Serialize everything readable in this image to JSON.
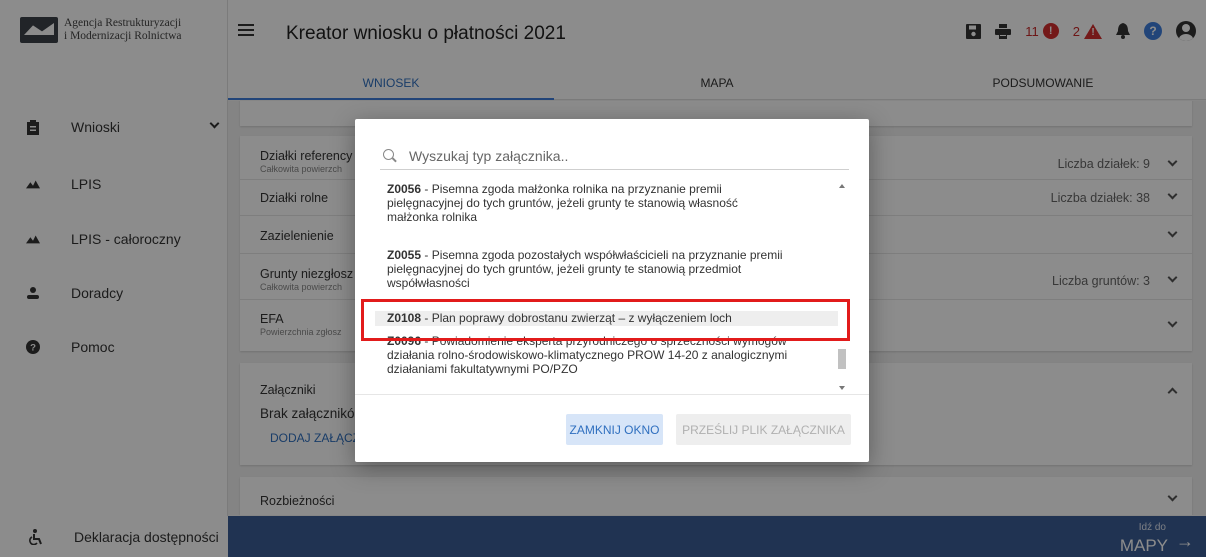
{
  "logo": {
    "line1": "Agencja Restrukturyzacji",
    "line2": "i Modernizacji Rolnictwa"
  },
  "sidebar": {
    "items": [
      {
        "label": "Wnioski",
        "icon": "clipboard-icon"
      },
      {
        "label": "LPIS",
        "icon": "mountain-icon"
      },
      {
        "label": "LPIS - całoroczny",
        "icon": "mountain-icon"
      },
      {
        "label": "Doradcy",
        "icon": "person-icon"
      },
      {
        "label": "Pomoc",
        "icon": "help-icon"
      }
    ],
    "accessibility": "Deklaracja dostępności"
  },
  "header": {
    "title": "Kreator wniosku o płatności 2021",
    "errors_count": "11",
    "warnings_count": "2",
    "errors_glyph": "!",
    "warnings_glyph": "!",
    "help_glyph": "?"
  },
  "tabs": [
    {
      "label": "WNIOSEK",
      "active": true
    },
    {
      "label": "MAPA",
      "active": false
    },
    {
      "label": "PODSUMOWANIE",
      "active": false
    }
  ],
  "content": {
    "rows": [
      {
        "title": "Działki referency",
        "sub": "Całkowita powierzch",
        "count": "Liczba działek: 9"
      },
      {
        "title": "Działki rolne",
        "sub": "",
        "count": "Liczba działek: 38"
      },
      {
        "title": "Zazielenienie",
        "sub": "",
        "count": ""
      },
      {
        "title": "Grunty niezgłosz",
        "sub": "Całkowita powierzch",
        "count": "Liczba gruntów: 3"
      },
      {
        "title": "EFA",
        "sub": "Powierzchnia zgłosz",
        "count": ""
      }
    ],
    "attachments": {
      "title": "Załączniki",
      "empty": "Brak załącznikó",
      "add": "DODAJ ZAŁĄCZ"
    },
    "discrepancies": "Rozbieżności"
  },
  "modal": {
    "search_placeholder": "Wyszukaj typ załącznika..",
    "items": [
      {
        "code": "Z0056",
        "line1": " - Pisemna zgoda małżonka rolnika na przyznanie premii",
        "line2": "pielęgnacyjnej do tych gruntów, jeżeli grunty te stanowią własność",
        "line3": "małżonka rolnika"
      },
      {
        "code": "Z0055",
        "line1": " - Pisemna zgoda pozostałych współwłaścicieli na przyznanie premii",
        "line2": "pielęgnacyjnej do tych gruntów, jeżeli grunty te stanowią przedmiot",
        "line3": "współwłasności"
      },
      {
        "code": "Z0108",
        "line1": " - Plan poprawy dobrostanu zwierząt – z wyłączeniem loch",
        "line2": "",
        "line3": ""
      },
      {
        "code": "Z0096",
        "line1": " - Powiadomienie eksperta przyrodniczego o sprzeczności wymogów",
        "line2": "działania rolno-środowiskowo-klimatycznego PROW 14-20 z analogicznymi",
        "line3": "działaniami fakultatywnymi PO/PZO"
      }
    ],
    "close_label": "ZAMKNIJ OKNO",
    "send_label": "PRZEŚLIJ PLIK ZAŁĄCZNIKA"
  },
  "bottom_bar": {
    "small": "Idź do",
    "big": "MAPY"
  }
}
